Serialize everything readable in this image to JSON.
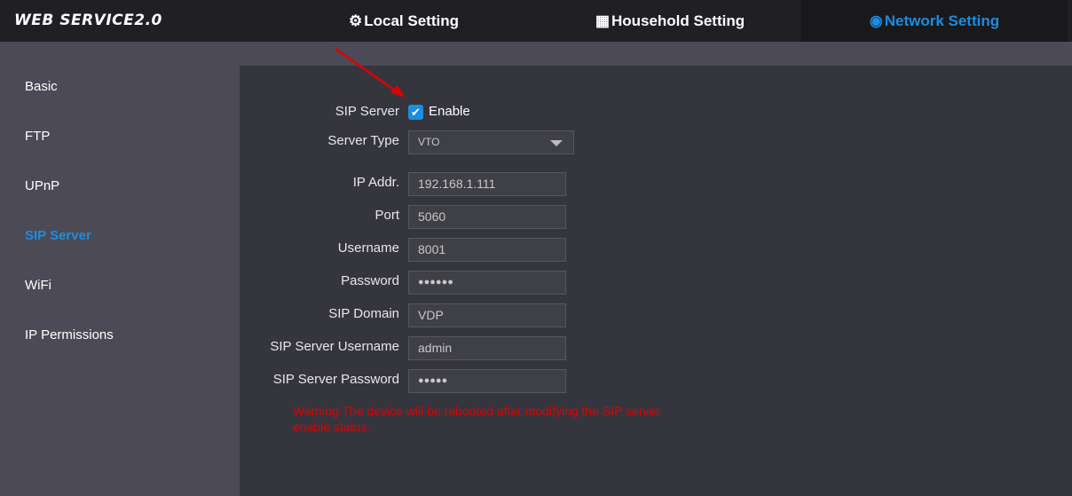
{
  "header": {
    "logo": "WEB SERVICE2.0",
    "tabs": [
      {
        "label": "Local Setting",
        "icon": "gear-icon"
      },
      {
        "label": "Household Setting",
        "icon": "building-icon"
      },
      {
        "label": "Network Setting",
        "icon": "globe-icon",
        "active": true
      }
    ]
  },
  "sidebar": {
    "items": [
      {
        "label": "Basic"
      },
      {
        "label": "FTP"
      },
      {
        "label": "UPnP"
      },
      {
        "label": "SIP Server",
        "active": true
      },
      {
        "label": "WiFi"
      },
      {
        "label": "IP Permissions"
      }
    ]
  },
  "form": {
    "sip_server": {
      "label": "SIP Server",
      "checkbox_label": "Enable",
      "checked": true
    },
    "server_type": {
      "label": "Server Type",
      "value": "VTO"
    },
    "ip_addr": {
      "label": "IP Addr.",
      "value": "192.168.1.111"
    },
    "port": {
      "label": "Port",
      "value": "5060"
    },
    "username": {
      "label": "Username",
      "value": "8001"
    },
    "password": {
      "label": "Password",
      "value": "●●●●●●"
    },
    "sip_domain": {
      "label": "SIP Domain",
      "value": "VDP"
    },
    "sip_server_username": {
      "label": "SIP Server Username",
      "value": "admin"
    },
    "sip_server_password": {
      "label": "SIP Server Password",
      "value": "●●●●●"
    },
    "warning": "Warning:The device will be rebooted after modifying the SIP server enable status."
  },
  "colors": {
    "accent": "#1e8ce0",
    "warning": "#e00000",
    "annotation_arrow": "#e00000"
  }
}
